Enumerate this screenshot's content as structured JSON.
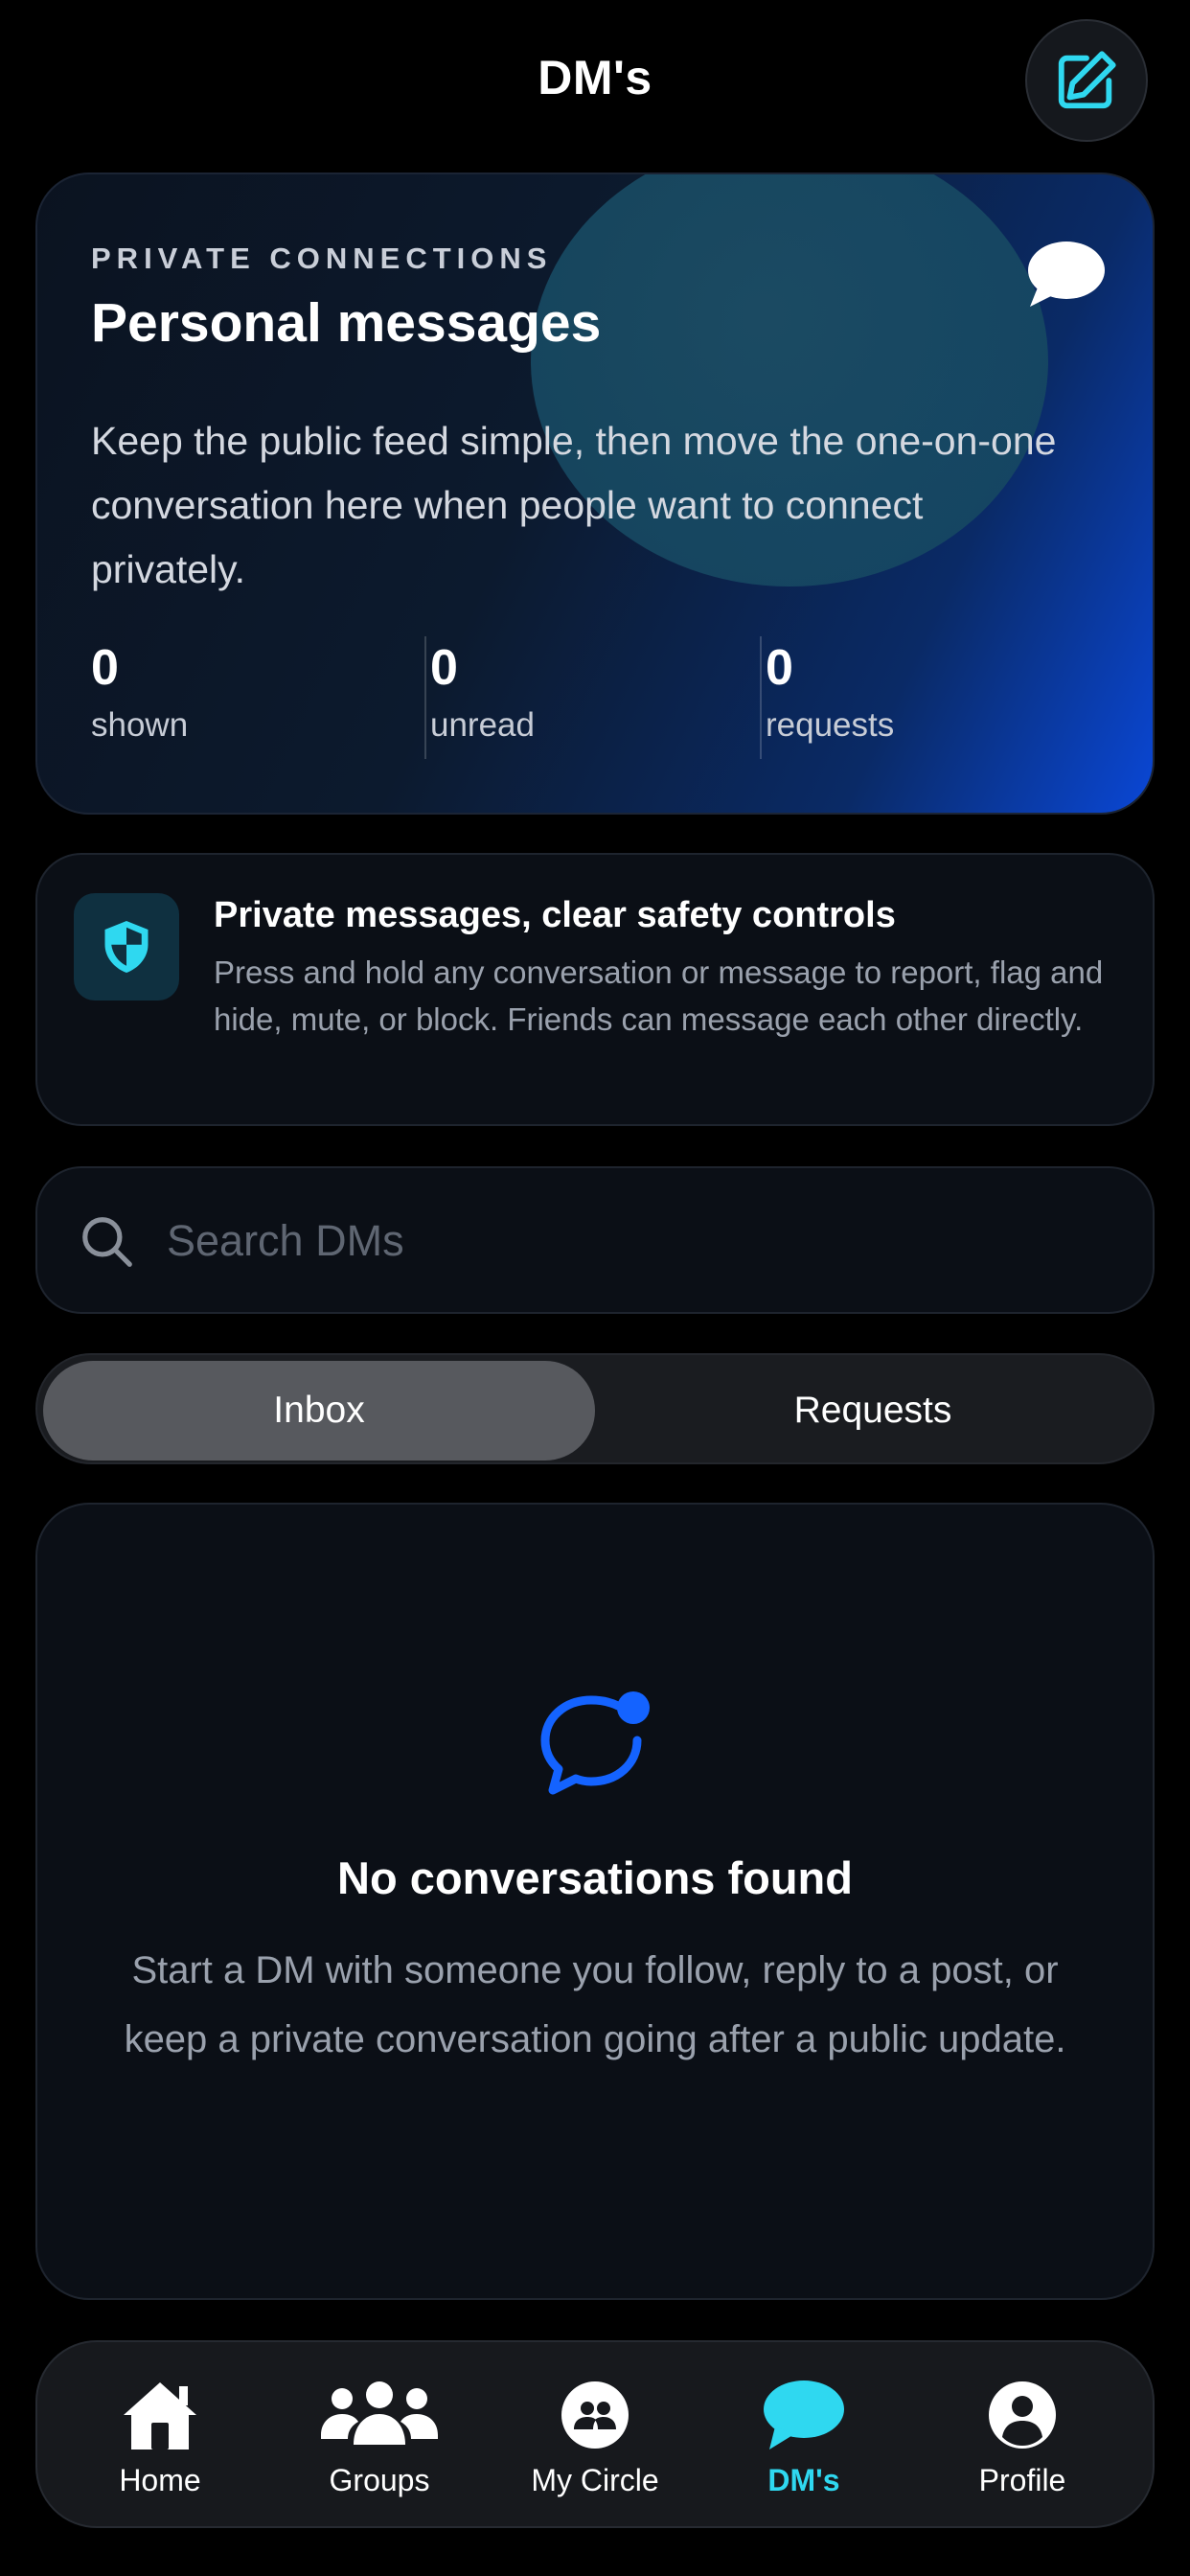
{
  "header": {
    "title": "DM's"
  },
  "hero": {
    "eyebrow": "PRIVATE CONNECTIONS",
    "title": "Personal messages",
    "description": "Keep the public feed simple, then move the one-on-one conversation here when people want to connect privately.",
    "stats": [
      {
        "value": "0",
        "label": "shown"
      },
      {
        "value": "0",
        "label": "unread"
      },
      {
        "value": "0",
        "label": "requests"
      }
    ]
  },
  "safety": {
    "title": "Private messages, clear safety controls",
    "description": "Press and hold any conversation or message to report, flag and hide, mute, or block. Friends can message each other directly."
  },
  "search": {
    "placeholder": "Search DMs",
    "value": ""
  },
  "tabs": {
    "inbox": "Inbox",
    "requests": "Requests",
    "selected": "Inbox"
  },
  "empty_state": {
    "title": "No conversations found",
    "description": "Start a DM with someone you follow, reply to a post, or keep a private conversation going after a public update."
  },
  "nav": {
    "items": [
      {
        "label": "Home",
        "icon": "home-icon"
      },
      {
        "label": "Groups",
        "icon": "groups-icon"
      },
      {
        "label": "My Circle",
        "icon": "circle-icon"
      },
      {
        "label": "DM's",
        "icon": "chat-bubble-icon",
        "active": true
      },
      {
        "label": "Profile",
        "icon": "profile-icon"
      }
    ]
  },
  "colors": {
    "accent": "#2fd8f0",
    "blue": "#1463ff",
    "background": "#000000"
  }
}
